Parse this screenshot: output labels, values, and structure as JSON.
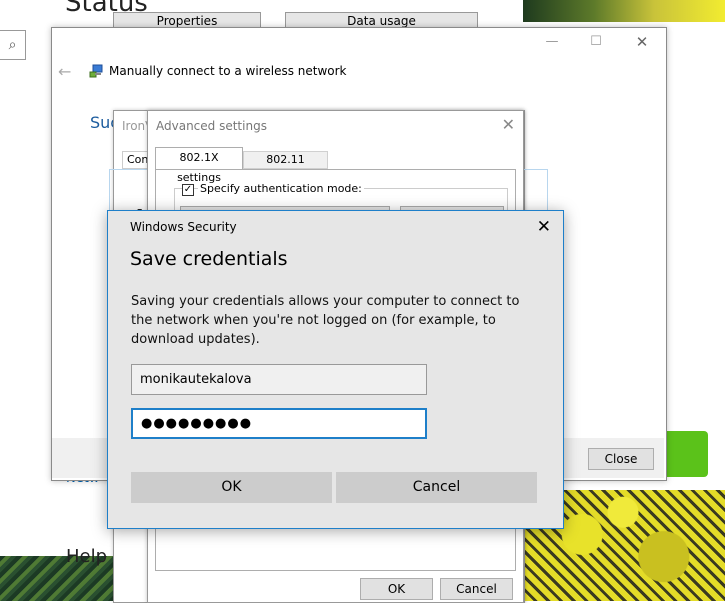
{
  "settings": {
    "title": "Status",
    "buttons": [
      "Properties",
      "Data usage"
    ],
    "search_icon": "⌕",
    "network_link": "Netw",
    "help": "Help"
  },
  "connect_dialog": {
    "title": "Manually connect to a wireless network",
    "success_text": "Suc",
    "close_button": "Close",
    "controls": {
      "minimize": "—",
      "maximize": "☐",
      "close": "✕"
    }
  },
  "ironv_dialog": {
    "title": "IronV",
    "tab": "Conn",
    "sec_label": "Se"
  },
  "advanced_settings": {
    "title": "Advanced settings",
    "tabs": [
      "802.1X settings",
      "802.11 settings"
    ],
    "checkbox_label": "Specify authentication mode:",
    "checkbox_checked": true,
    "ok_button": "OK",
    "cancel_button": "Cancel"
  },
  "security_dialog": {
    "app_title": "Windows Security",
    "heading": "Save credentials",
    "message": "Saving your credentials allows your computer to connect to the network when you're not logged on (for example, to download updates).",
    "username": "monikautekalova",
    "password_mask": "●●●●●●●●●",
    "ok_button": "OK",
    "cancel_button": "Cancel",
    "accent_color": "#1e7fc9"
  }
}
